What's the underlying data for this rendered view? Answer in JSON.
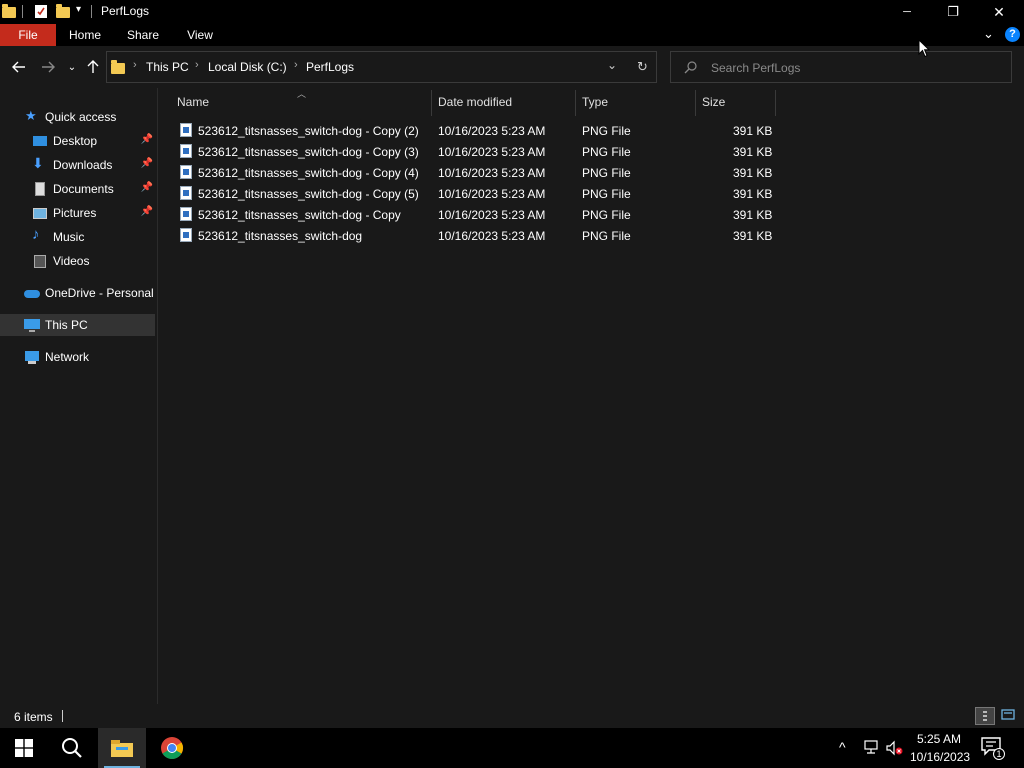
{
  "window": {
    "title": "PerfLogs",
    "controls": {
      "minimize": "─",
      "restore": "❐",
      "close": "✕"
    }
  },
  "ribbon": {
    "tabs": [
      "File",
      "Home",
      "Share",
      "View"
    ]
  },
  "address": {
    "crumbs": [
      "This PC",
      "Local Disk (C:)",
      "PerfLogs"
    ],
    "search_placeholder": "Search PerfLogs"
  },
  "sidebar": {
    "items": [
      {
        "label": "Quick access",
        "icon": "star-icon",
        "pinned": false
      },
      {
        "label": "Desktop",
        "icon": "desktop-icon",
        "pinned": true
      },
      {
        "label": "Downloads",
        "icon": "download-icon",
        "pinned": true
      },
      {
        "label": "Documents",
        "icon": "documents-icon",
        "pinned": true
      },
      {
        "label": "Pictures",
        "icon": "pictures-icon",
        "pinned": true
      },
      {
        "label": "Music",
        "icon": "music-icon",
        "pinned": false
      },
      {
        "label": "Videos",
        "icon": "videos-icon",
        "pinned": false
      },
      {
        "label": "OneDrive - Personal",
        "icon": "cloud-icon",
        "pinned": false
      },
      {
        "label": "This PC",
        "icon": "computer-icon",
        "pinned": false,
        "selected": true
      },
      {
        "label": "Network",
        "icon": "network-icon",
        "pinned": false
      }
    ]
  },
  "files": {
    "columns": [
      "Name",
      "Date modified",
      "Type",
      "Size"
    ],
    "rows": [
      {
        "name": "523612_titsnasses_switch-dog - Copy (2)",
        "date": "10/16/2023 5:23 AM",
        "type": "PNG File",
        "size": "391 KB"
      },
      {
        "name": "523612_titsnasses_switch-dog - Copy (3)",
        "date": "10/16/2023 5:23 AM",
        "type": "PNG File",
        "size": "391 KB"
      },
      {
        "name": "523612_titsnasses_switch-dog - Copy (4)",
        "date": "10/16/2023 5:23 AM",
        "type": "PNG File",
        "size": "391 KB"
      },
      {
        "name": "523612_titsnasses_switch-dog - Copy (5)",
        "date": "10/16/2023 5:23 AM",
        "type": "PNG File",
        "size": "391 KB"
      },
      {
        "name": "523612_titsnasses_switch-dog - Copy",
        "date": "10/16/2023 5:23 AM",
        "type": "PNG File",
        "size": "391 KB"
      },
      {
        "name": "523612_titsnasses_switch-dog",
        "date": "10/16/2023 5:23 AM",
        "type": "PNG File",
        "size": "391 KB"
      }
    ]
  },
  "status": {
    "item_count": "6 items"
  },
  "taskbar": {
    "time": "5:25 AM",
    "date": "10/16/2023",
    "notification_count": "1"
  },
  "colors": {
    "file_tab": "#c42b1c",
    "background": "#191919",
    "selected": "#333333",
    "accent_blue": "#0a84ff"
  }
}
